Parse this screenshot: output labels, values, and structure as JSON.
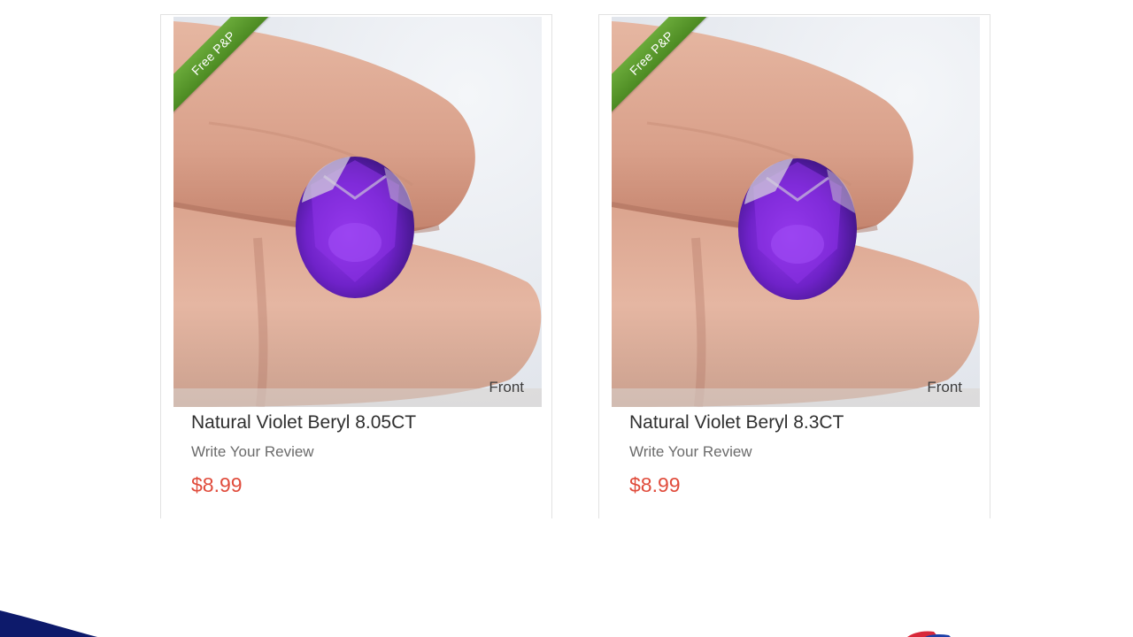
{
  "products": [
    {
      "title": "Natural Violet Beryl 8.05CT",
      "review_link": "Write Your Review",
      "price": "$8.99",
      "ribbon": "Free P&P",
      "image_label": "Front"
    },
    {
      "title": "Natural Violet Beryl 8.3CT",
      "review_link": "Write Your Review",
      "price": "$8.99",
      "ribbon": "Free P&P",
      "image_label": "Front"
    }
  ],
  "colors": {
    "price": "#e04c3c",
    "ribbon": "#5a9a2c",
    "gem": "#7a2bd6",
    "skin": "#d9a58c",
    "border": "#e2e2e2"
  },
  "icons": {
    "ribbon": "free-shipping-ribbon",
    "gem": "violet-gemstone"
  }
}
